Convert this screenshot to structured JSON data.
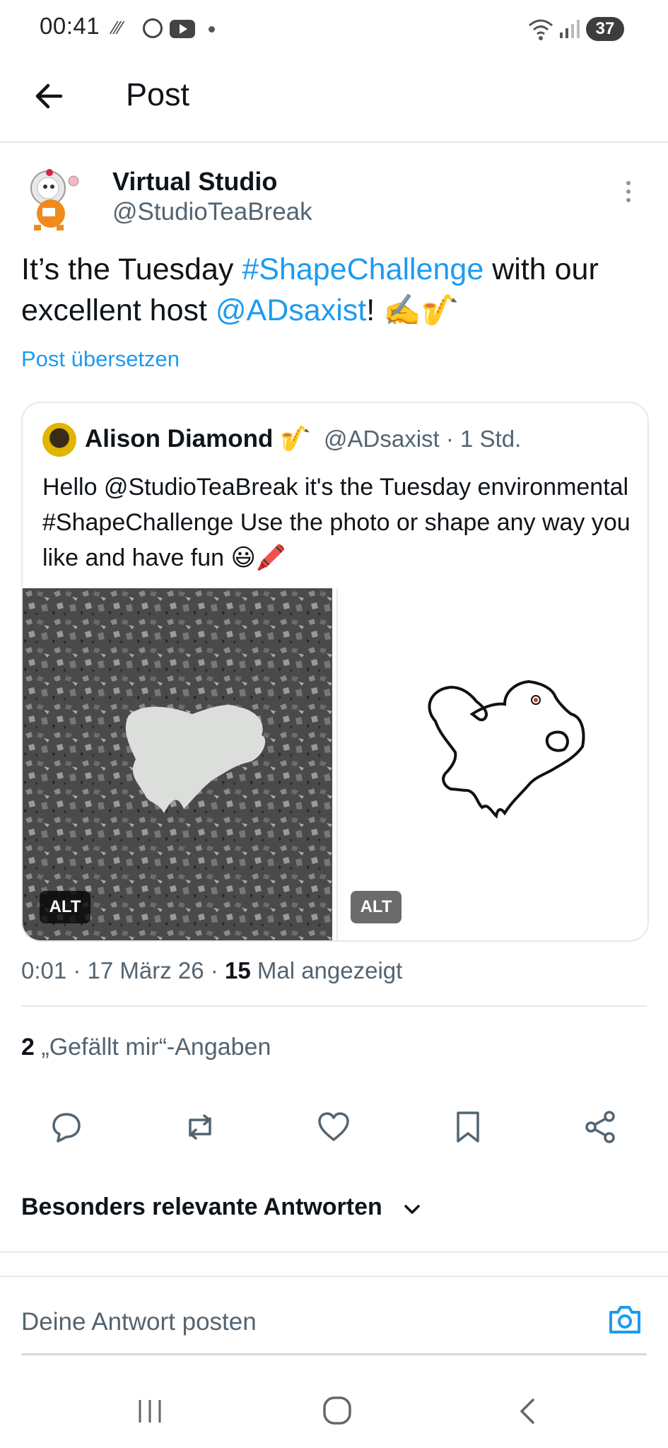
{
  "status_bar": {
    "time": "00:41",
    "battery": "37"
  },
  "header": {
    "title": "Post"
  },
  "post": {
    "display_name": "Virtual Studio",
    "handle": "@StudioTeaBreak",
    "text_part1": "It’s the Tuesday ",
    "hashtag": "#ShapeChallenge",
    "text_part2": " with our excellent host ",
    "mention": "@ADsaxist",
    "text_part3": "! ✍️🎷",
    "translate_label": "Post übersetzen"
  },
  "quote": {
    "display_name": "Alison Diamond 🎷",
    "meta": "@ADsaxist · 1 Std.",
    "text": "Hello @StudioTeaBreak it's the Tuesday environmental #ShapeChallenge Use the photo or shape any way you like and have fun 😃🖍️",
    "alt_label_left": "ALT",
    "alt_label_right": "ALT"
  },
  "meta": {
    "time_date": "0:01 · 17 März 26 · ",
    "views_count": "15",
    "views_label": " Mal angezeigt"
  },
  "likes": {
    "count": "2",
    "label": " „Gefällt mir“-Angaben"
  },
  "replies_header": "Besonders relevante Antworten",
  "reply_input": {
    "placeholder": "Deine Antwort posten"
  },
  "colors": {
    "link": "#1d9bf0",
    "secondary": "#536471",
    "text": "#0f1419"
  }
}
